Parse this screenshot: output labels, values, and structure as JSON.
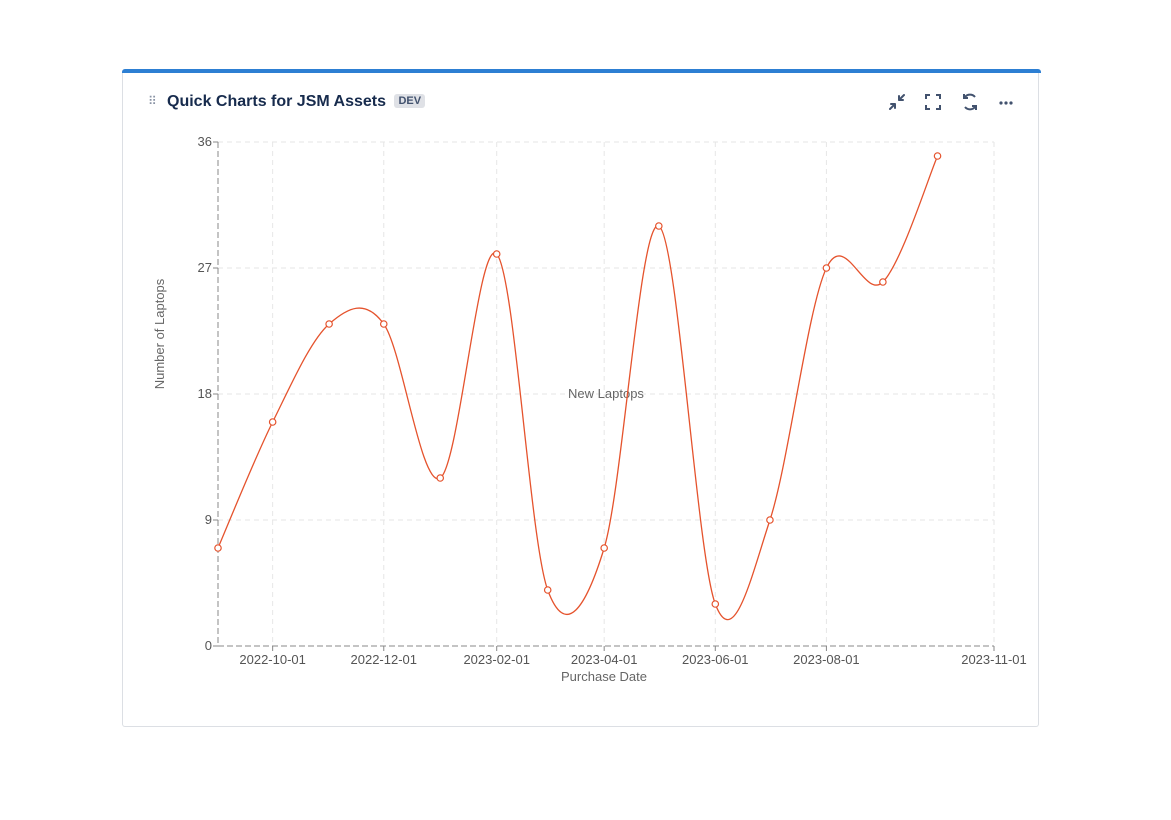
{
  "widget": {
    "title": "Quick Charts for JSM Assets",
    "badge": "DEV",
    "accent_color": "#2d7fd3",
    "actions": [
      {
        "name": "collapse-icon"
      },
      {
        "name": "fullscreen-icon"
      },
      {
        "name": "refresh-icon"
      },
      {
        "name": "more-icon"
      }
    ]
  },
  "chart_data": {
    "type": "line",
    "series_label": "New Laptops",
    "xlabel": "Purchase Date",
    "ylabel": "Number of Laptops",
    "ylim": [
      0,
      36
    ],
    "yticks": [
      0,
      9,
      18,
      27,
      36
    ],
    "xticks": [
      "2022-10-01",
      "2022-12-01",
      "2023-02-01",
      "2023-04-01",
      "2023-06-01",
      "2023-08-01",
      "2023-11-01"
    ],
    "grid": true,
    "line_color": "#e5532d",
    "series": [
      {
        "x": [
          "2022-09-01",
          "2022-10-01",
          "2022-11-01",
          "2022-12-01",
          "2023-01-01",
          "2023-02-01",
          "2023-03-01",
          "2023-04-01",
          "2023-05-01",
          "2023-06-01",
          "2023-07-01",
          "2023-08-01",
          "2023-09-01",
          "2023-10-01"
        ],
        "values": [
          7,
          16,
          23,
          23,
          12,
          28,
          4,
          7,
          30,
          3,
          9,
          27,
          26,
          35
        ]
      }
    ]
  }
}
